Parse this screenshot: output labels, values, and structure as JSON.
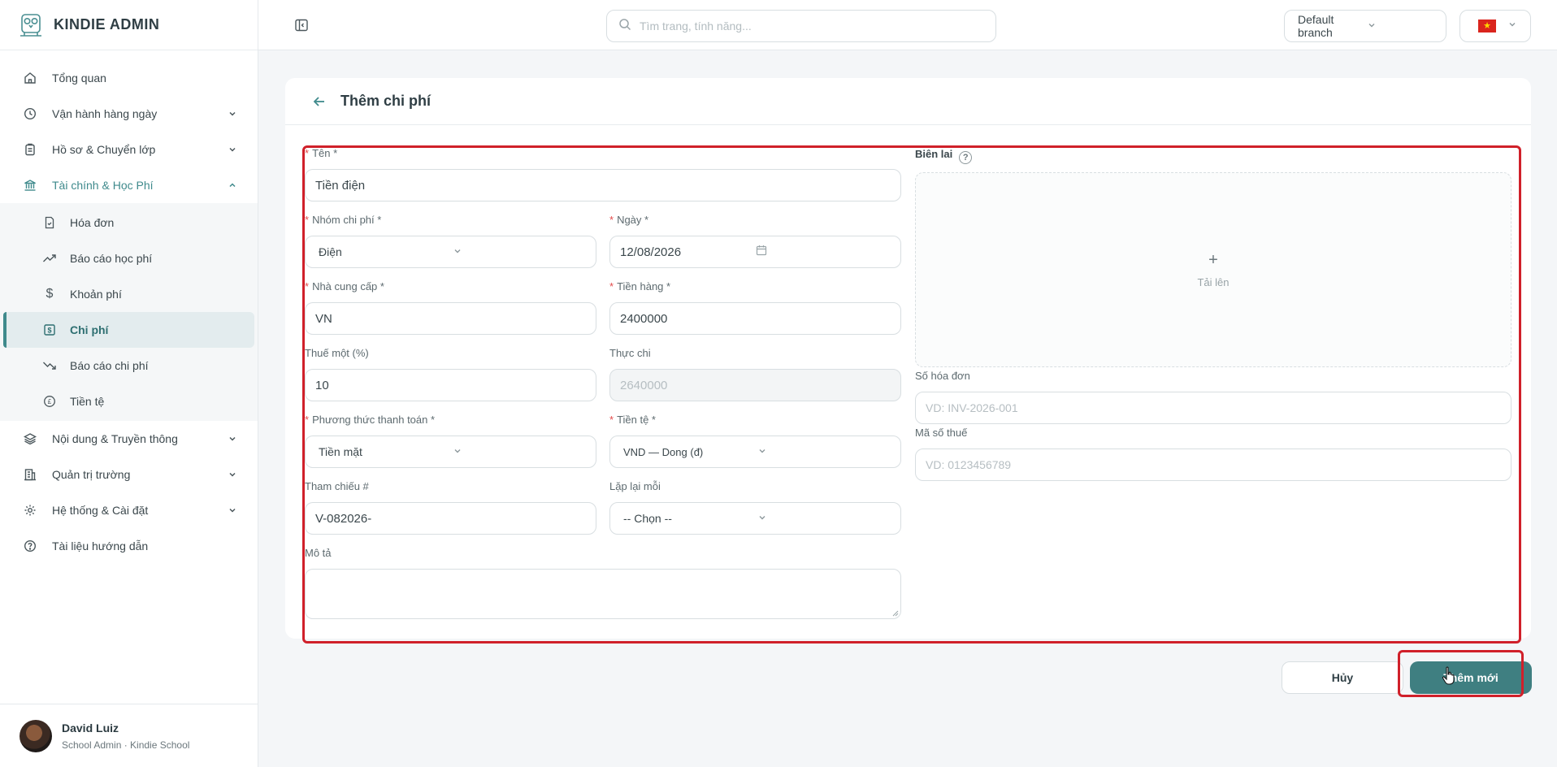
{
  "app": {
    "name": "KINDIE ADMIN"
  },
  "header": {
    "search_placeholder": "Tìm trang, tính năng...",
    "branch": "Default branch"
  },
  "sidebar": {
    "items": [
      {
        "label": "Tổng quan",
        "icon": "home-icon"
      },
      {
        "label": "Vận hành hàng ngày",
        "icon": "clock-icon"
      },
      {
        "label": "Hồ sơ & Chuyển lớp",
        "icon": "clipboard-icon"
      },
      {
        "label": "Tài chính & Học Phí",
        "icon": "bank-icon"
      }
    ],
    "finance_sub": [
      {
        "label": "Hóa đơn",
        "icon": "invoice-icon"
      },
      {
        "label": "Báo cáo học phí",
        "icon": "trend-up-icon"
      },
      {
        "label": "Khoản phí",
        "icon": "dollar-icon"
      },
      {
        "label": "Chi phí",
        "icon": "expense-icon"
      },
      {
        "label": "Báo cáo chi phí",
        "icon": "trend-down-icon"
      },
      {
        "label": "Tiền tệ",
        "icon": "currency-icon"
      }
    ],
    "items_after": [
      {
        "label": "Nội dung & Truyền thông",
        "icon": "layers-icon"
      },
      {
        "label": "Quản trị trường",
        "icon": "building-icon"
      },
      {
        "label": "Hệ thống & Cài đặt",
        "icon": "gear-icon"
      },
      {
        "label": "Tài liệu hướng dẫn",
        "icon": "help-circle-icon"
      }
    ]
  },
  "user": {
    "name": "David Luiz",
    "role": "School Admin · Kindie School"
  },
  "page": {
    "title": "Thêm chi phí"
  },
  "form": {
    "name": {
      "label": "Tên *",
      "value": "Tiền điện"
    },
    "category": {
      "label": "Nhóm chi phí *",
      "value": "Điện"
    },
    "date": {
      "label": "Ngày *",
      "value": "12/08/2026"
    },
    "vendor": {
      "label": "Nhà cung cấp *",
      "value": "VN"
    },
    "amount": {
      "label": "Tiền hàng *",
      "value": "2400000"
    },
    "tax": {
      "label": "Thuế một (%)",
      "value": "10"
    },
    "actual": {
      "label": "Thực chi",
      "value": "2640000"
    },
    "payment": {
      "label": "Phương thức thanh toán *",
      "value": "Tiền mặt"
    },
    "currency": {
      "label": "Tiền tệ *",
      "value": "VND — Dong (đ)"
    },
    "reference": {
      "label": "Tham chiếu #",
      "value": "V-082026-"
    },
    "repeat": {
      "label": "Lặp lại mỗi",
      "value": "-- Chọn --"
    },
    "description": {
      "label": "Mô tả",
      "value": ""
    },
    "receipt": {
      "label": "Biên lai",
      "upload": "Tải lên"
    },
    "invoice_no": {
      "label": "Số hóa đơn",
      "placeholder": "VD: INV-2026-001"
    },
    "tax_code": {
      "label": "Mã số thuế",
      "placeholder": "VD: 0123456789"
    }
  },
  "actions": {
    "cancel": "Hủy",
    "submit": "Thêm mới"
  },
  "colors": {
    "accent": "#3f7f81",
    "required": "#e34b4b",
    "highlight": "#d0202a"
  }
}
